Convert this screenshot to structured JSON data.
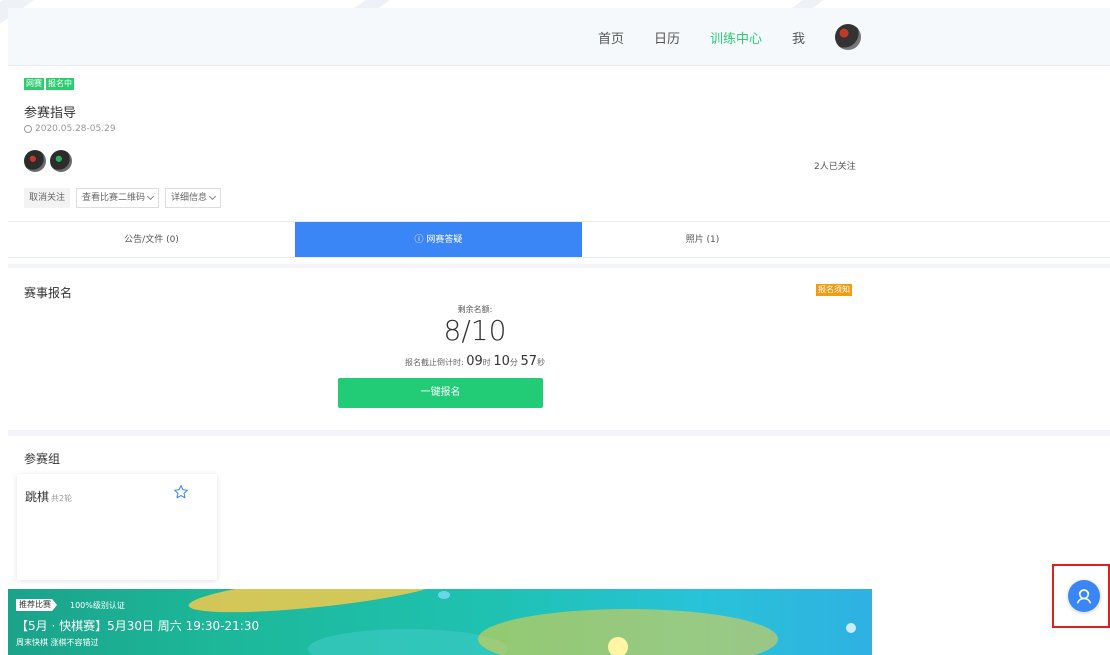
{
  "nav": {
    "items": [
      {
        "label": "首页",
        "active": false
      },
      {
        "label": "日历",
        "active": false
      },
      {
        "label": "训练中心",
        "active": true
      },
      {
        "label": "我",
        "active": false
      }
    ]
  },
  "event": {
    "tags": [
      "网赛",
      "报名中"
    ],
    "title": "参赛指导",
    "date": "2020.05.28-05.29",
    "follow_count": "2人已关注",
    "actions": {
      "unfollow": "取消关注",
      "qr": "查看比赛二维码",
      "details": "详细信息"
    }
  },
  "tabs": [
    {
      "label": "公告/文件 (0)",
      "active": false
    },
    {
      "label": "网赛答疑",
      "active": true
    },
    {
      "label": "照片 (1)",
      "active": false
    }
  ],
  "registration": {
    "title": "赛事报名",
    "notice": "报名须知",
    "remaining_label": "剩余名额:",
    "remaining": "8/10",
    "countdown_label": "报名截止倒计时:",
    "countdown": {
      "hours": "09",
      "h_unit": "时",
      "minutes": "10",
      "m_unit": "分",
      "seconds": "57",
      "s_unit": "秒"
    },
    "signup_label": "一键报名"
  },
  "groups": {
    "title": "参赛组",
    "items": [
      {
        "name": "跳棋",
        "rounds": "共2轮"
      }
    ]
  },
  "banner": {
    "label": "推荐比赛",
    "cert": "100%级别认证",
    "title": "【5月 · 快棋赛】5月30日 周六 19:30-21:30",
    "subtitle": "周末快棋 涨棋不容错过"
  },
  "colors": {
    "accent_green": "#22cc77",
    "accent_blue": "#3a86f7",
    "notice_orange": "#f39c12",
    "highlight_red": "#e02020"
  }
}
